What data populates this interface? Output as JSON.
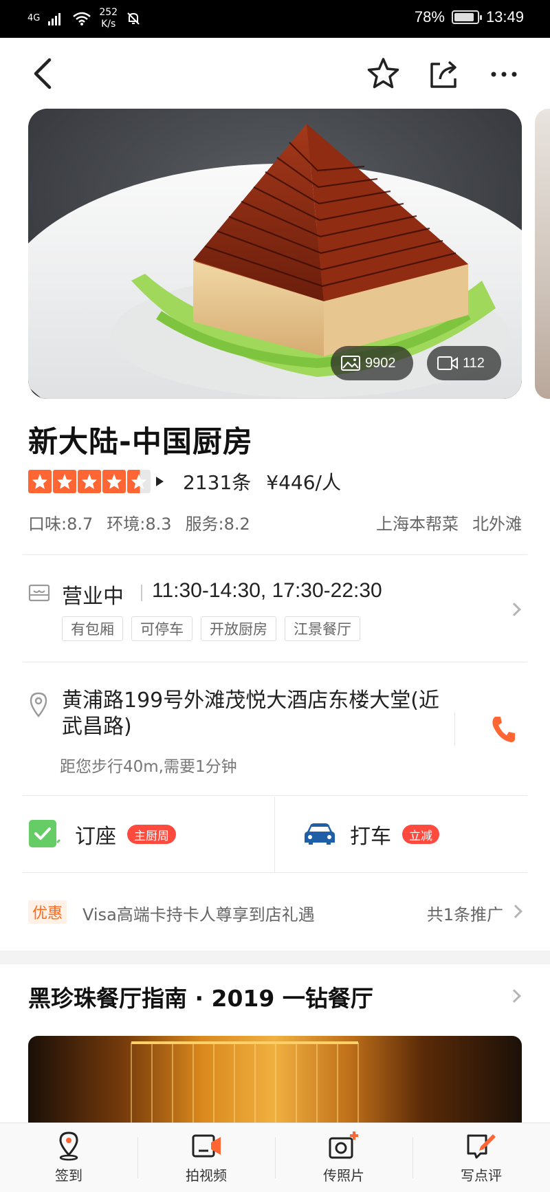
{
  "status_bar": {
    "network": "4G",
    "speed_value": "252",
    "speed_unit": "K/s",
    "battery": "78%",
    "time": "13:49"
  },
  "hero": {
    "photo_count": "9902",
    "video_count": "112"
  },
  "restaurant": {
    "name": "新大陆-中国厨房",
    "rating_stars": 4.5,
    "review_count": "2131条",
    "price_per_person": "¥446/人",
    "scores": [
      "口味:8.7",
      "环境:8.3",
      "服务:8.2"
    ],
    "cuisine": "上海本帮菜",
    "district": "北外滩"
  },
  "hours": {
    "status": "营业中",
    "time": "11:30-14:30, 17:30-22:30",
    "feature_tags": [
      "有包厢",
      "可停车",
      "开放厨房",
      "江景餐厅"
    ]
  },
  "address": {
    "text": "黄浦路199号外滩茂悦大酒店东楼大堂(近武昌路)",
    "distance": "距您步行40m,需要1分钟"
  },
  "actions": {
    "reserve_label": "订座",
    "reserve_badge": "主厨周",
    "taxi_label": "打车",
    "taxi_badge": "立减"
  },
  "promo": {
    "tag": "优惠",
    "text": "Visa高端卡持卡人尊享到店礼遇",
    "count": "共1条推广"
  },
  "guide": {
    "title": "黑珍珠餐厅指南 · 2019 一钻餐厅"
  },
  "tabbar": [
    {
      "label": "签到"
    },
    {
      "label": "拍视频"
    },
    {
      "label": "传照片"
    },
    {
      "label": "写点评"
    }
  ],
  "colors": {
    "accent": "#ff6633",
    "badge_red": "#ff4a3d",
    "reserve_green": "#66cc66",
    "taxi_blue": "#1e5fa8",
    "phone_orange": "#ff6633"
  }
}
